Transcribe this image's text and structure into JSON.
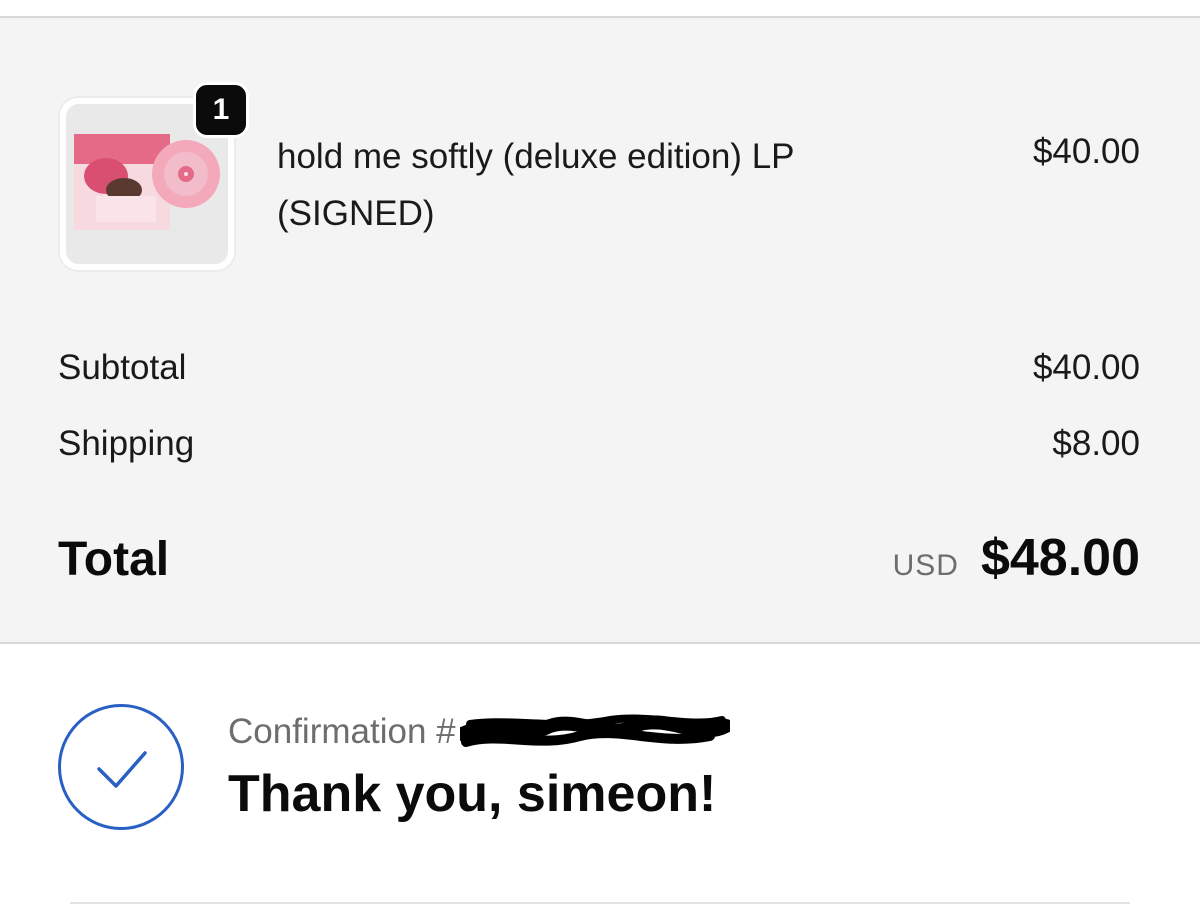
{
  "order": {
    "item": {
      "title": "hold me softly (deluxe edition) LP (SIGNED)",
      "price": "$40.00",
      "quantity": "1",
      "image_icon": "album-cover-thumbnail"
    },
    "subtotal_label": "Subtotal",
    "subtotal_value": "$40.00",
    "shipping_label": "Shipping",
    "shipping_value": "$8.00",
    "total_label": "Total",
    "currency": "USD",
    "total_value": "$48.00"
  },
  "confirmation": {
    "label": "Confirmation #",
    "thank_you": "Thank you, simeon!",
    "icon": "check-circle-icon"
  },
  "colors": {
    "summary_bg": "#f4f4f4",
    "accent_blue": "#2a5fc4",
    "badge_bg": "#0b0b0b",
    "muted_text": "#6d6d6d"
  }
}
